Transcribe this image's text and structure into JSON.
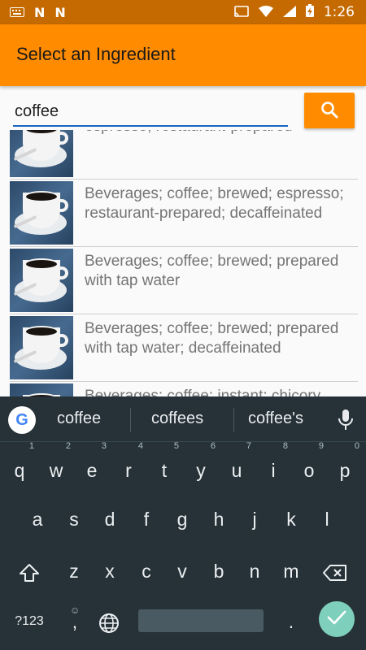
{
  "status_bar": {
    "left_icons": [
      "keyboard-icon",
      "notification-n-icon",
      "notification-n-icon"
    ],
    "right_icons": [
      "cast-icon",
      "wifi-icon",
      "signal-icon",
      "battery-charging-icon"
    ],
    "time": "1:26"
  },
  "app_bar": {
    "title": "Select an Ingredient"
  },
  "search": {
    "value": "coffee",
    "button_icon": "search-icon"
  },
  "results": [
    {
      "label": "espresso; restaurant-prepared"
    },
    {
      "label": "Beverages; coffee; brewed; espresso; restaurant-prepared; decaffeinated"
    },
    {
      "label": "Beverages; coffee; brewed; prepared with tap water"
    },
    {
      "label": "Beverages; coffee; brewed; prepared with tap water; decaffeinated"
    },
    {
      "label": "Beverages; coffee; instant; chicory"
    }
  ],
  "keyboard": {
    "suggestions": [
      "coffee",
      "coffees",
      "coffee's"
    ],
    "row1": [
      "q",
      "w",
      "e",
      "r",
      "t",
      "y",
      "u",
      "i",
      "o",
      "p"
    ],
    "row1_hints": [
      "1",
      "2",
      "3",
      "4",
      "5",
      "6",
      "7",
      "8",
      "9",
      "0"
    ],
    "row2": [
      "a",
      "s",
      "d",
      "f",
      "g",
      "h",
      "j",
      "k",
      "l"
    ],
    "row3": [
      "z",
      "x",
      "c",
      "v",
      "b",
      "n",
      "m"
    ],
    "symbols_label": "?123",
    "emoji_comma": ",",
    "period": "."
  },
  "colors": {
    "status_bar": "#c56a00",
    "app_bar": "#ff8c00",
    "keyboard_bg": "#263238",
    "accent_underline": "#1565c0",
    "enter_key": "#7fcfbd"
  }
}
